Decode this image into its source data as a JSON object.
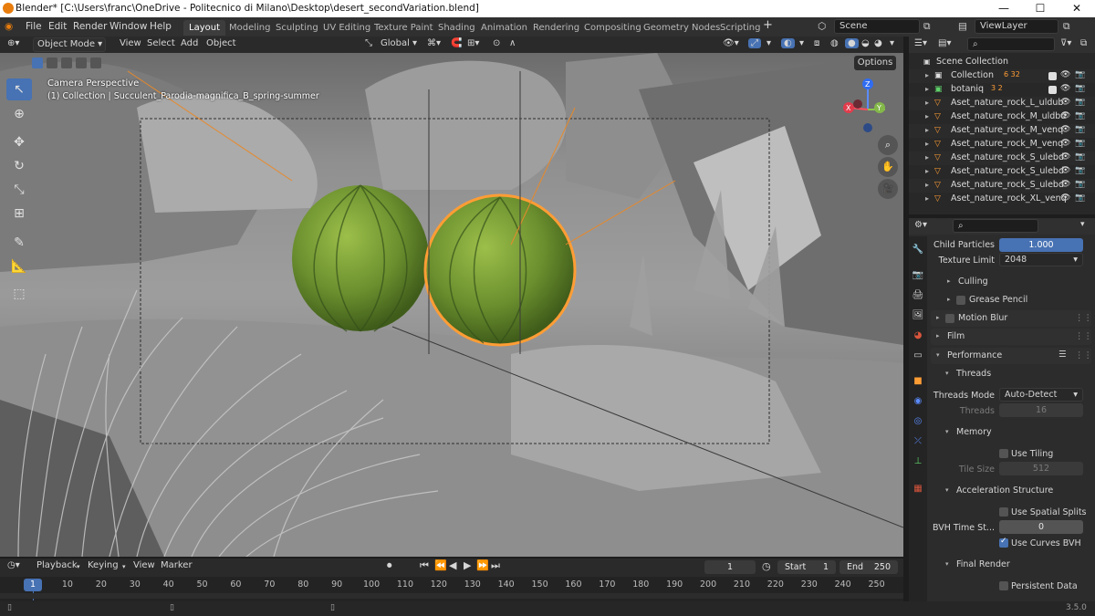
{
  "titlebar": {
    "title": "Blender* [C:\\Users\\franc\\OneDrive - Politecnico di Milano\\Desktop\\desert_secondVariation.blend]",
    "minimize": "—",
    "maximize": "☐",
    "close": "✕"
  },
  "menu": {
    "file": "File",
    "edit": "Edit",
    "render": "Render",
    "window": "Window",
    "help": "Help"
  },
  "workspaces": [
    "Layout",
    "Modeling",
    "Sculpting",
    "UV Editing",
    "Texture Paint",
    "Shading",
    "Animation",
    "Rendering",
    "Compositing",
    "Geometry Nodes",
    "Scripting"
  ],
  "workspace_add": "+",
  "scene": {
    "label": "Scene",
    "view_layer": "ViewLayer"
  },
  "viewport_header": {
    "mode": "Object Mode",
    "view": "View",
    "select": "Select",
    "add": "Add",
    "object": "Object",
    "orientation": "Global",
    "options": "Options"
  },
  "viewport": {
    "camera": "Camera Perspective",
    "collection": "(1) Collection | Succulent_Parodia-magnifica_B_spring-summer",
    "axis_x": "X",
    "axis_y": "Y",
    "axis_z": "Z"
  },
  "outliner": {
    "scene_collection": "Scene Collection",
    "items": [
      {
        "name": "Collection",
        "badges": "6  32"
      },
      {
        "name": "botaniq",
        "badges": "3  2"
      },
      {
        "name": "Aset_nature_rock_L_uldub"
      },
      {
        "name": "Aset_nature_rock_M_uldbd"
      },
      {
        "name": "Aset_nature_rock_M_venq"
      },
      {
        "name": "Aset_nature_rock_M_venq"
      },
      {
        "name": "Aset_nature_rock_S_ulebd"
      },
      {
        "name": "Aset_nature_rock_S_ulebd"
      },
      {
        "name": "Aset_nature_rock_S_ulebd"
      },
      {
        "name": "Aset_nature_rock_XL_venq"
      }
    ]
  },
  "properties": {
    "child_particles_label": "Child Particles",
    "child_particles_value": "1.000",
    "texture_limit_label": "Texture Limit",
    "texture_limit_value": "2048",
    "culling": "Culling",
    "grease_pencil": "Grease Pencil",
    "motion_blur": "Motion Blur",
    "film": "Film",
    "performance": "Performance",
    "threads": "Threads",
    "threads_mode_label": "Threads Mode",
    "threads_mode_value": "Auto-Detect",
    "threads_label": "Threads",
    "threads_value": "16",
    "memory": "Memory",
    "use_tiling": "Use Tiling",
    "tile_size_label": "Tile Size",
    "tile_size_value": "512",
    "acceleration": "Acceleration Structure",
    "spatial_splits": "Use Spatial Splits",
    "bvh_label": "BVH Time St...",
    "bvh_value": "0",
    "curves_bvh": "Use Curves BVH",
    "final_render": "Final Render",
    "persistent_data": "Persistent Data"
  },
  "timeline": {
    "playback": "Playback",
    "keying": "Keying",
    "view": "View",
    "marker": "Marker",
    "current_frame": "1",
    "start_label": "Start",
    "start_value": "1",
    "end_label": "End",
    "end_value": "250",
    "ticks": [
      "1",
      "10",
      "20",
      "30",
      "40",
      "50",
      "60",
      "70",
      "80",
      "90",
      "100",
      "110",
      "120",
      "130",
      "140",
      "150",
      "160",
      "170",
      "180",
      "190",
      "200",
      "210",
      "220",
      "230",
      "240",
      "250"
    ]
  },
  "status": {
    "version": "3.5.0"
  },
  "colors": {
    "accent": "#4772b3",
    "selection": "#ff9d35",
    "cactus": "#6b8f2e"
  }
}
